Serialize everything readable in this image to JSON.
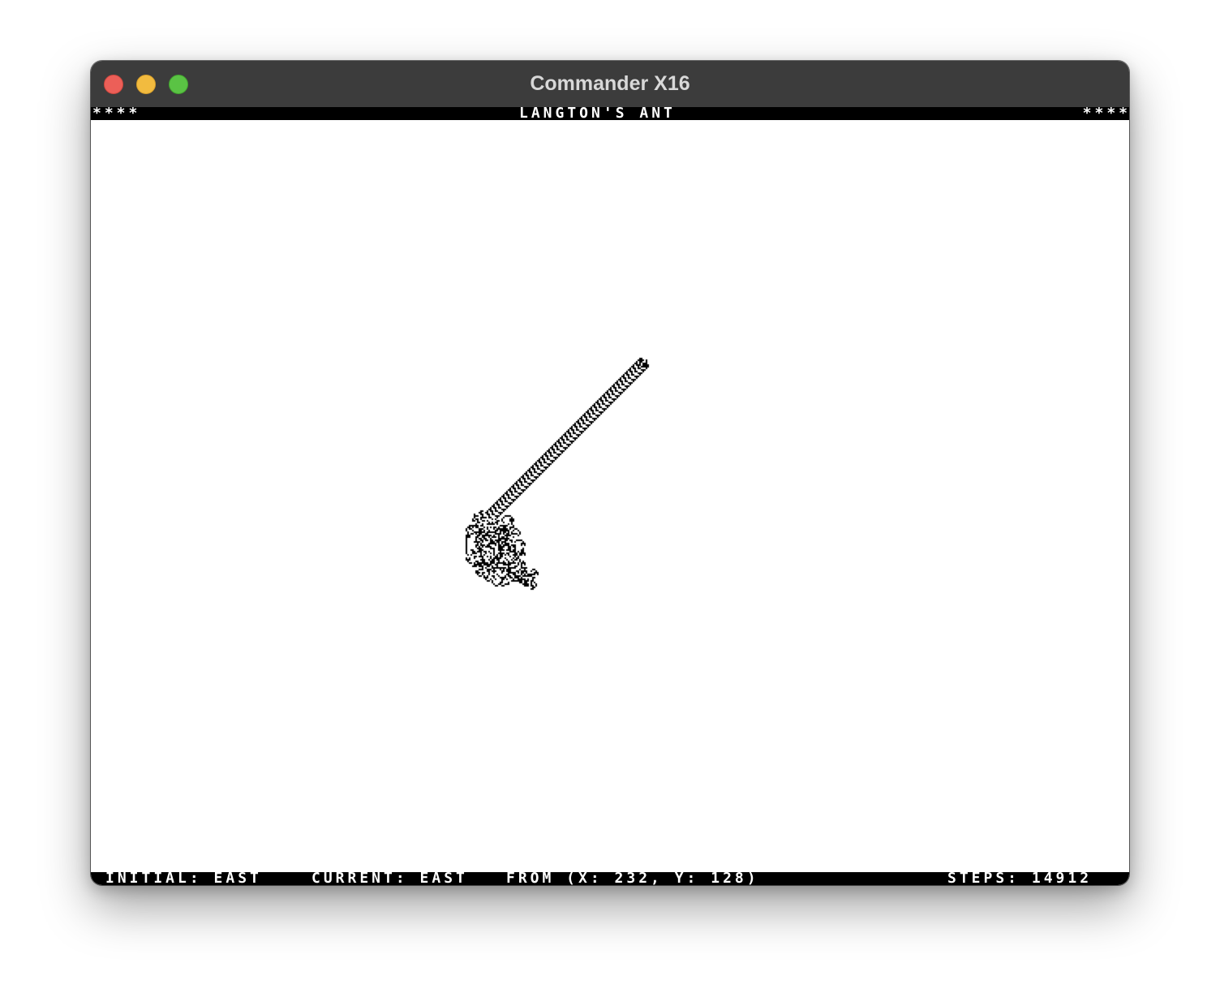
{
  "window": {
    "title": "Commander X16",
    "controls": {
      "close_color": "#ec5f58",
      "minimize_color": "#f2bb3f",
      "maximize_color": "#5ac344"
    }
  },
  "header": {
    "stars_left": "****",
    "title": "LANGTON'S ANT",
    "stars_right": "****"
  },
  "status": {
    "initial": "INITIAL: EAST",
    "current": "CURRENT: EAST",
    "from": "FROM (X: 232, Y: 128)",
    "steps": "STEPS: 14912"
  },
  "colors": {
    "screen_bg": "#ffffff",
    "ink": "#000000",
    "bar_bg": "#000000",
    "bar_text": "#ffffff",
    "titlebar_bg": "#3c3c3c",
    "title_text": "#d8d8d8"
  }
}
